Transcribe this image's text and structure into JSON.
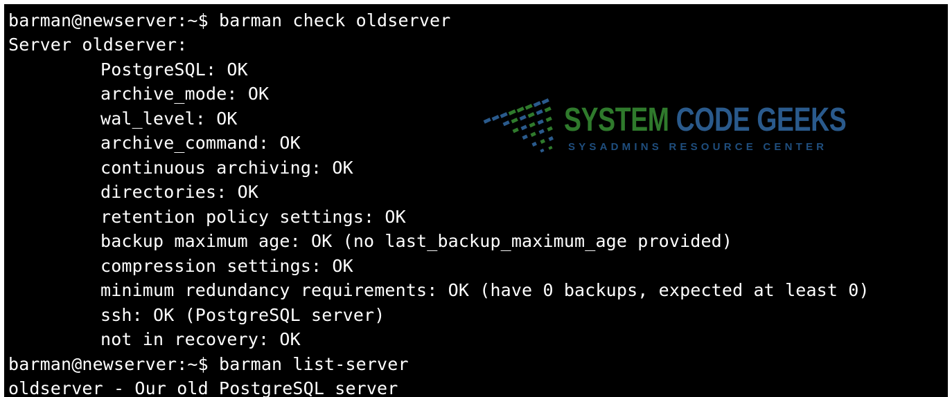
{
  "terminal": {
    "lines": [
      "barman@newserver:~$ barman check oldserver",
      "Server oldserver:",
      "PostgreSQL: OK",
      "archive_mode: OK",
      "wal_level: OK",
      "archive_command: OK",
      "continuous archiving: OK",
      "directories: OK",
      "retention policy settings: OK",
      "backup maximum age: OK (no last_backup_maximum_age provided)",
      "compression settings: OK",
      "minimum redundancy requirements: OK (have 0 backups, expected at least 0)",
      "ssh: OK (PostgreSQL server)",
      "not in recovery: OK",
      "barman@newserver:~$ barman list-server",
      "oldserver - Our old PostgreSQL server"
    ]
  },
  "watermark": {
    "word_one": "SYSTEM",
    "word_two": "CODE GEEKS",
    "subtitle": "SYSADMINS RESOURCE CENTER",
    "colors": {
      "green": "#2f7a2c",
      "blue": "#2a5a8c"
    }
  }
}
